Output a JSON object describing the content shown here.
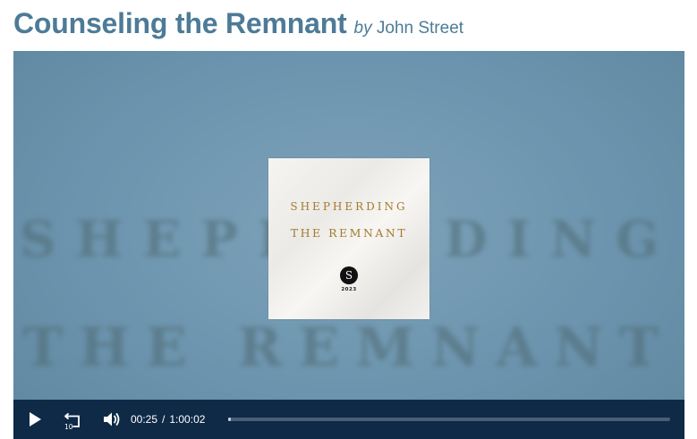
{
  "header": {
    "title": "Counseling the Remnant",
    "by": "by",
    "author": "John Street"
  },
  "poster": {
    "background_line_1": "SHEPHERDING",
    "background_line_2": "THE REMNANT",
    "artwork_line_1": "SHEPHERDING",
    "artwork_line_2": "THE REMNANT",
    "artwork_logo": "S",
    "artwork_year": "2023"
  },
  "player": {
    "current_time": "00:25",
    "separator": "/",
    "duration": "1:00:02",
    "rewind_seconds": "10",
    "progress_fraction": 0.007,
    "controls_bg": "#0f2a47",
    "accent": "#4d7b97"
  }
}
